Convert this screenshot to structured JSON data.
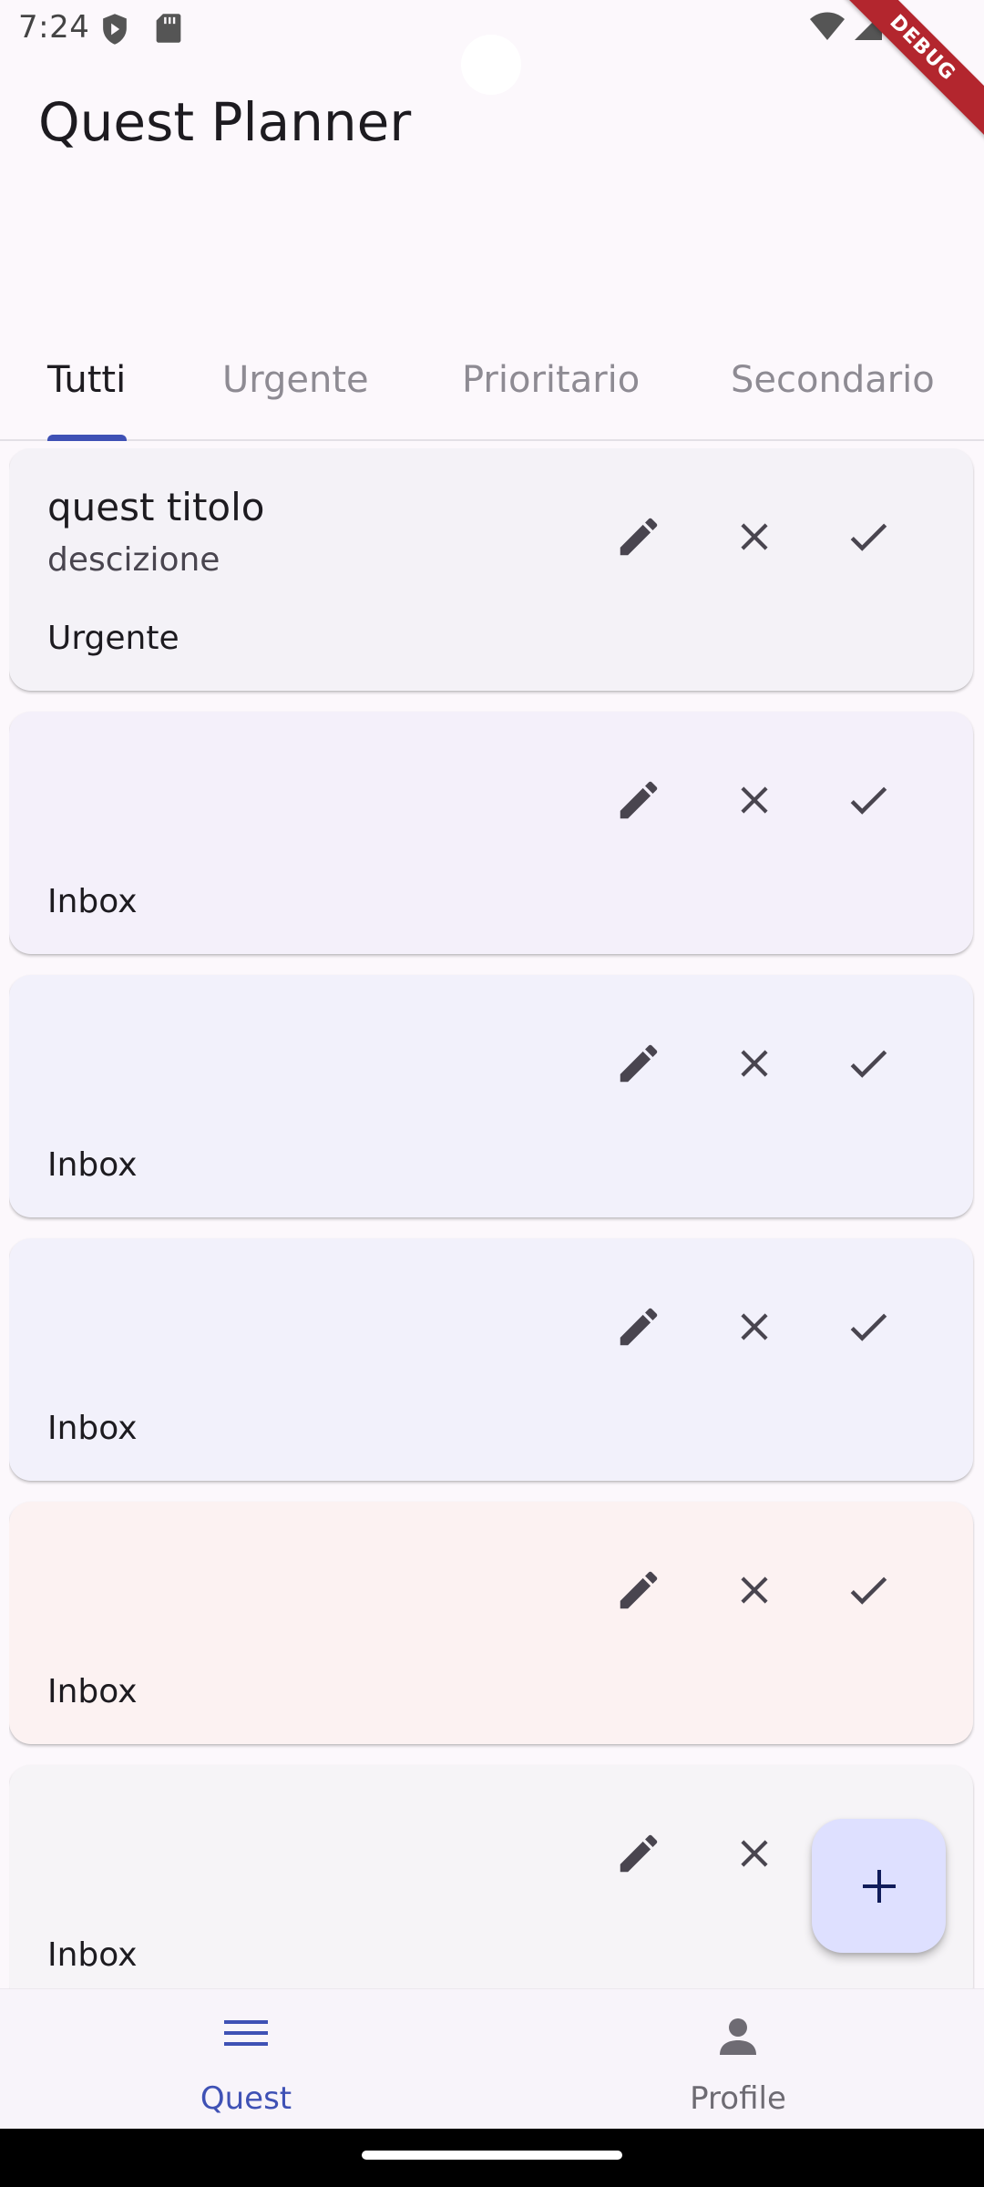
{
  "status_bar": {
    "time": "7:24",
    "debug_label": "DEBUG"
  },
  "app": {
    "title": "Quest Planner"
  },
  "tabs": [
    {
      "label": "Tutti",
      "active": true
    },
    {
      "label": "Urgente",
      "active": false
    },
    {
      "label": "Prioritario",
      "active": false
    },
    {
      "label": "Secondario",
      "active": false
    }
  ],
  "quests": [
    {
      "title": "quest titolo",
      "description": "descizione",
      "category": "Urgente",
      "background": "#f4f2f7",
      "actions": [
        "edit-icon",
        "close-icon",
        "check-icon"
      ]
    },
    {
      "title": "",
      "description": "",
      "category": "Inbox",
      "background": "#f4f0fa",
      "actions": [
        "edit-icon",
        "close-icon",
        "check-icon"
      ]
    },
    {
      "title": "",
      "description": "",
      "category": "Inbox",
      "background": "#f2f1fb",
      "actions": [
        "edit-icon",
        "close-icon",
        "check-icon"
      ]
    },
    {
      "title": "",
      "description": "",
      "category": "Inbox",
      "background": "#f2f1fb",
      "actions": [
        "edit-icon",
        "close-icon",
        "check-icon"
      ]
    },
    {
      "title": "",
      "description": "",
      "category": "Inbox",
      "background": "#fcf2f2",
      "actions": [
        "edit-icon",
        "close-icon",
        "check-icon"
      ]
    },
    {
      "title": "",
      "description": "",
      "category": "Inbox",
      "background": "#f6f4f7",
      "actions": [
        "edit-icon",
        "close-icon",
        "check-icon"
      ]
    }
  ],
  "fab": {
    "icon": "plus-icon",
    "background": "#dee0ff"
  },
  "bottom_nav": [
    {
      "label": "Quest",
      "icon": "menu-icon",
      "active": true
    },
    {
      "label": "Profile",
      "icon": "person-icon",
      "active": false
    }
  ],
  "colors": {
    "accent": "#3f51b5",
    "icon": "#49454f",
    "inactive_text": "#8e8b93"
  }
}
